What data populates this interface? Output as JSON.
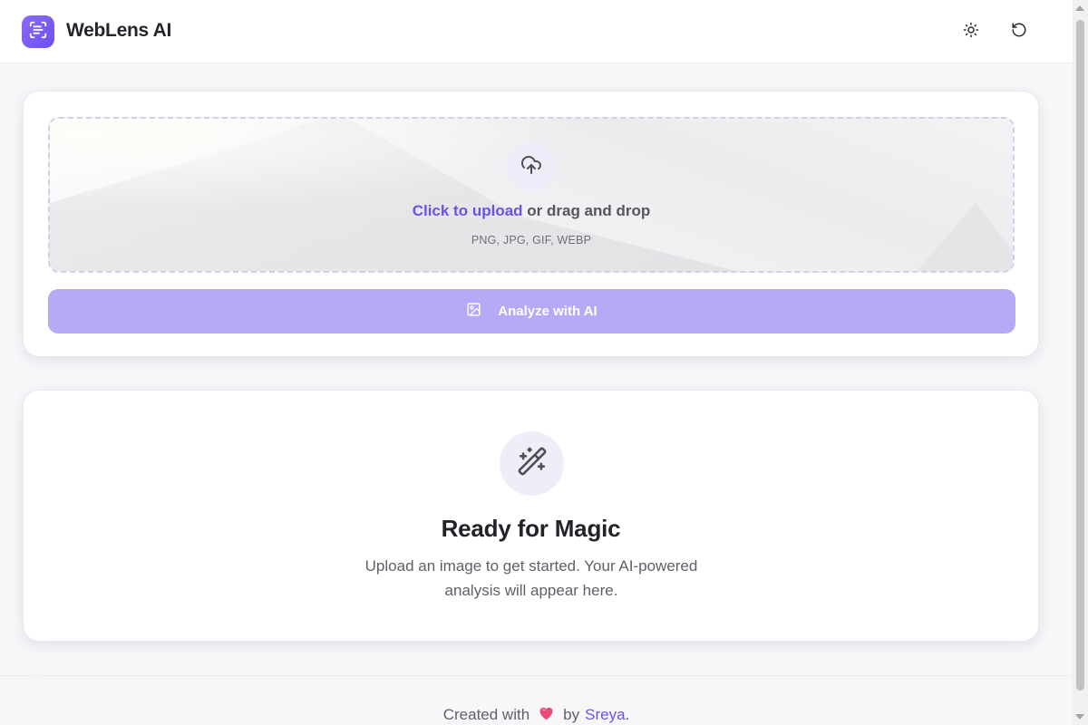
{
  "app": {
    "title": "WebLens AI",
    "logo_icon": "scan-text-icon"
  },
  "header": {
    "theme_toggle_icon": "sun-icon",
    "reset_icon": "rotate-ccw-icon"
  },
  "upload": {
    "icon": "cloud-upload-icon",
    "link_text": "Click to upload",
    "rest_text": " or drag and drop",
    "formats": "PNG, JPG, GIF, WEBP",
    "analyze_icon": "image-icon",
    "analyze_label": "Analyze with AI"
  },
  "result": {
    "icon": "magic-wand-icon",
    "title": "Ready for Magic",
    "description": "Upload an image to get started. Your AI-powered analysis will appear here."
  },
  "footer": {
    "prefix": "Created with",
    "heart_icon": "heart-icon",
    "by": "by",
    "author": "Sreya",
    "suffix": "."
  },
  "colors": {
    "accent": "#6d52e8",
    "button_disabled": "#b6a9f6",
    "heart": "#e84a7a"
  }
}
